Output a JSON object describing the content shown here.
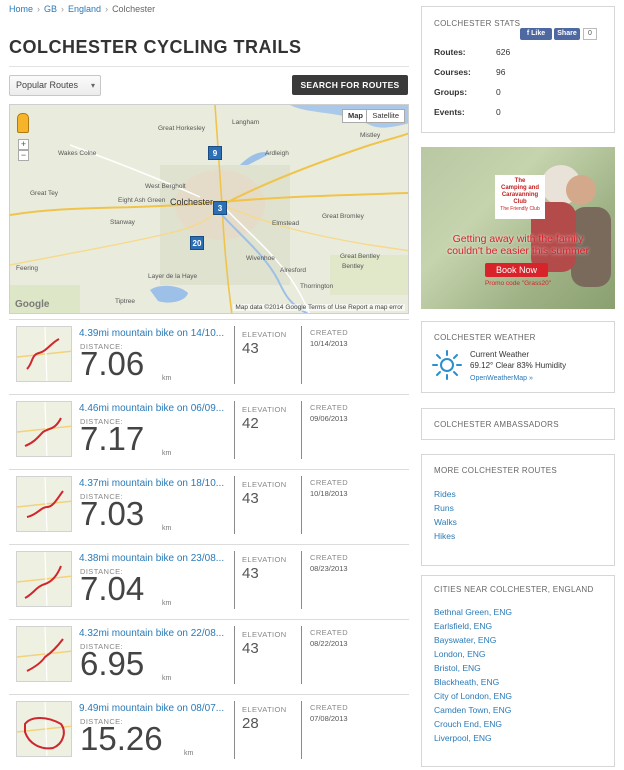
{
  "breadcrumb": {
    "home": "Home",
    "country": "GB",
    "region": "England",
    "city": "Colchester"
  },
  "page_title": "COLCHESTER CYCLING TRAILS",
  "controls": {
    "sort_select": "Popular Routes",
    "search_button": "SEARCH FOR ROUTES"
  },
  "map": {
    "type_map": "Map",
    "type_satellite": "Satellite",
    "zoom_in": "+",
    "zoom_out": "−",
    "footer": "Map data ©2014 Google   Terms of Use   Report a map error",
    "google": "Google",
    "markers": [
      "9",
      "3",
      "20"
    ],
    "labels": {
      "l1": "Great Horkesley",
      "l2": "Langham",
      "l3": "Mistley",
      "l4": "Wakes Colne",
      "l5": "Ardleigh",
      "l6": "Great Tey",
      "l7": "Eight Ash Green",
      "l8": "West Bergholt",
      "l9": "Colchester",
      "l10": "Great Bromley",
      "l11": "Stanway",
      "l12": "Elmstead",
      "l13": "Wivenhoe",
      "l14": "Alresford",
      "l15": "Feering",
      "l16": "Layer de la Haye",
      "l17": "Thorrington",
      "l18": "Tiptree",
      "l19": "Great Bentley",
      "l20": "Bentley"
    }
  },
  "labels": {
    "distance": "DISTANCE:",
    "elevation": "ELEVATION",
    "created": "CREATED"
  },
  "routes": [
    {
      "name": "4.39mi mountain bike on 14/10...",
      "distance": "7.06",
      "unit": "km",
      "elevation": "43",
      "created": "10/14/2013"
    },
    {
      "name": "4.46mi mountain bike on 06/09...",
      "distance": "7.17",
      "unit": "km",
      "elevation": "42",
      "created": "09/06/2013"
    },
    {
      "name": "4.37mi mountain bike on 18/10...",
      "distance": "7.03",
      "unit": "km",
      "elevation": "43",
      "created": "10/18/2013"
    },
    {
      "name": "4.38mi mountain bike on 23/08...",
      "distance": "7.04",
      "unit": "km",
      "elevation": "43",
      "created": "08/23/2013"
    },
    {
      "name": "4.32mi mountain bike on 22/08...",
      "distance": "6.95",
      "unit": "km",
      "elevation": "43",
      "created": "08/22/2013"
    },
    {
      "name": "9.49mi mountain bike on 08/07...",
      "distance": "15.26",
      "unit": "km",
      "elevation": "28",
      "created": "07/08/2013"
    }
  ],
  "stats": {
    "title": "COLCHESTER STATS",
    "fb_like": "Like",
    "fb_share": "Share",
    "fb_count": "0",
    "rows": [
      {
        "label": "Routes:",
        "value": "626"
      },
      {
        "label": "Courses:",
        "value": "96"
      },
      {
        "label": "Groups:",
        "value": "0"
      },
      {
        "label": "Events:",
        "value": "0"
      }
    ]
  },
  "ad": {
    "logo_line1": "The",
    "logo_line2": "Camping and",
    "logo_line3": "Caravanning",
    "logo_line4": "Club",
    "logo_line5": "The Friendly Club",
    "tagline1": "Getting away with the family",
    "tagline2": "couldn't be easier this summer",
    "button": "Book Now",
    "promo": "Promo code \"Grass20\""
  },
  "weather": {
    "title": "COLCHESTER WEATHER",
    "current": "Current Weather",
    "conditions": "69.12° Clear 83% Humidity",
    "source": "OpenWeatherMap »",
    "icon": "sun-icon"
  },
  "ambassadors": {
    "title": "COLCHESTER AMBASSADORS"
  },
  "more_routes": {
    "title": "MORE COLCHESTER ROUTES",
    "items": [
      "Rides",
      "Runs",
      "Walks",
      "Hikes"
    ]
  },
  "cities": {
    "title": "CITIES NEAR COLCHESTER, ENGLAND",
    "items": [
      "Bethnal Green, ENG",
      "Earlsfield, ENG",
      "Bayswater, ENG",
      "London, ENG",
      "Bristol, ENG",
      "Blackheath, ENG",
      "City of London, ENG",
      "Camden Town, ENG",
      "Crouch End, ENG",
      "Liverpool, ENG"
    ]
  },
  "colors": {
    "link": "#2a7ab8",
    "button_dark": "#3a3a3a",
    "fb_blue": "#4e69a2",
    "ad_red": "#d8232a",
    "marker_blue": "#2d6fb5"
  }
}
